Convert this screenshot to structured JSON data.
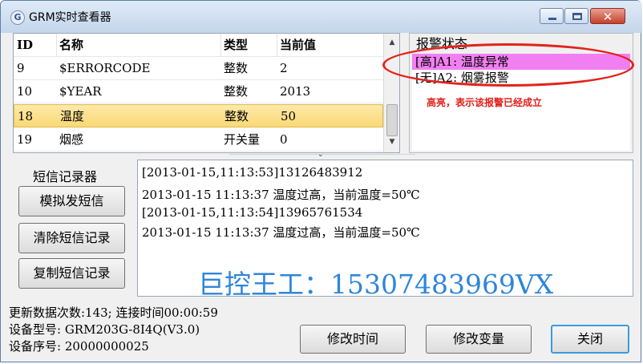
{
  "window": {
    "title": "GRM实时查看器",
    "app_icon": "G"
  },
  "title_controls": {
    "close_glyph": "✕"
  },
  "variables": {
    "headers": [
      "ID",
      "名称",
      "类型",
      "当前值"
    ],
    "rows": [
      {
        "id": "9",
        "name": "$ERRORCODE",
        "type": "整数",
        "value": "2"
      },
      {
        "id": "10",
        "name": "$YEAR",
        "type": "整数",
        "value": "2013"
      },
      {
        "id": "18",
        "name": "温度",
        "type": "整数",
        "value": "50",
        "selected": true
      },
      {
        "id": "19",
        "name": "烟感",
        "type": "开关量",
        "value": "0"
      }
    ]
  },
  "alarm": {
    "title": "报警状态",
    "items": [
      "[高]A1: 温度异常",
      "[无]A2: 烟雾报警"
    ],
    "note": "高亮，表示该报警已经成立",
    "highlight_color": "#f27ff2"
  },
  "sms": {
    "label": "短信记录器",
    "buttons": {
      "simulate": "模拟发短信",
      "clear": "清除短信记录",
      "copy": "复制短信记录"
    },
    "log": [
      "[2013-01-15,11:13:53]13126483912",
      "2013-01-15 11:13:37 温度过高，当前温度=50℃",
      "[2013-01-15,11:13:54]13965761534",
      "2013-01-15 11:13:37 温度过高，当前温度=50℃"
    ],
    "watermark": "巨控王工：15307483969VX"
  },
  "status": {
    "update_line": "更新数据次数:143; 连接时间00:00:59",
    "model_line": "设备型号: GRM203G-8I4Q(V3.0)",
    "serial_line": "设备序号: 20000000025"
  },
  "actions": {
    "edit_time": "修改时间",
    "edit_var": "修改变量",
    "close": "关闭"
  }
}
